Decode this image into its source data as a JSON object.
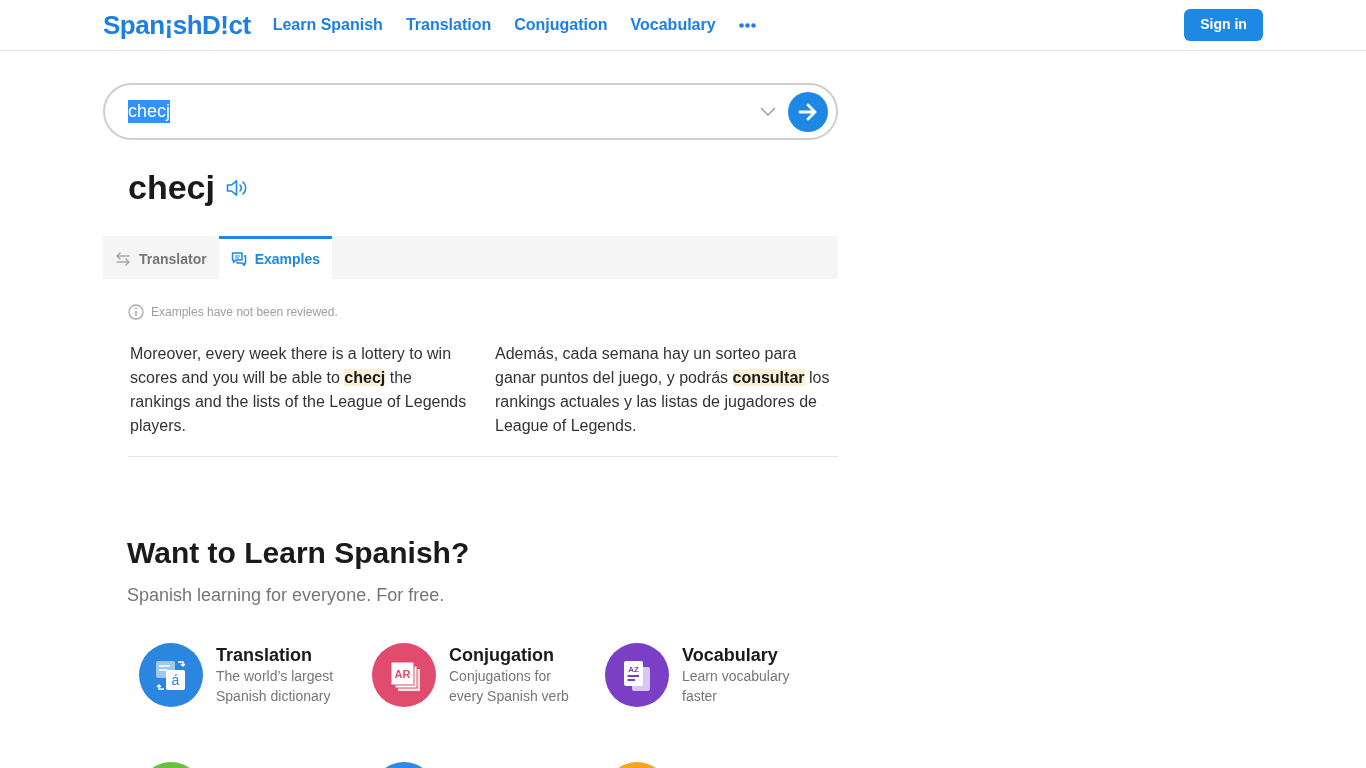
{
  "header": {
    "logo": "Span¡shD!ct",
    "nav": [
      "Learn Spanish",
      "Translation",
      "Conjugation",
      "Vocabulary"
    ],
    "sign_in": "Sign in"
  },
  "search": {
    "value": "checj",
    "value_selected": true
  },
  "entry": {
    "headword": "checj"
  },
  "tabs": [
    {
      "label": "Translator",
      "selected": false
    },
    {
      "label": "Examples",
      "selected": true
    }
  ],
  "examples": {
    "notice": "Examples have not been reviewed.",
    "pairs": [
      {
        "source": "Moreover, every week there is a lottery to win scores and you will be able to **checj** the rankings and the lists of the League of Legends players.",
        "target": "Además, cada semana hay un sorteo para ganar puntos del juego, y podrás **consultar** los rankings actuales y las listas de jugadores de League of Legends."
      }
    ]
  },
  "learn": {
    "title": "Want to Learn Spanish?",
    "subtitle": "Spanish learning for everyone. For free.",
    "features": [
      {
        "title": "Translation",
        "description": "The world’s largest Spanish dictionary",
        "icon_label": "á",
        "color": "#2b86e0"
      },
      {
        "title": "Conjugation",
        "description": "Conjugations for every Spanish verb",
        "icon_label": "AR",
        "color": "#e04b6e"
      },
      {
        "title": "Vocabulary",
        "description": "Learn vocabulary faster",
        "icon_label": "AZ",
        "color": "#7b3fc6"
      }
    ],
    "more_features": [
      {
        "color": "#6bbf3f"
      },
      {
        "color": "#2e8ae4"
      },
      {
        "color": "#f4a621"
      }
    ]
  }
}
